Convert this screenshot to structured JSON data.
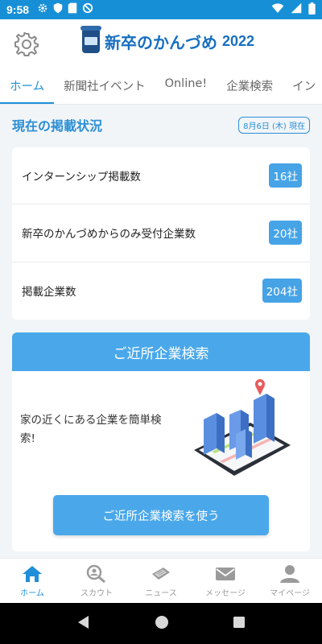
{
  "status_bar": {
    "time": "9:58",
    "left_icons": [
      "gear-icon",
      "shield-icon",
      "sd-card-icon",
      "no-disturb-icon"
    ],
    "right_icons": [
      "wifi-icon",
      "signal-icon",
      "battery-icon"
    ]
  },
  "header": {
    "logo_text": "新卒のかんづめ",
    "logo_year": "2022"
  },
  "tabs": [
    {
      "label": "ホーム",
      "active": true
    },
    {
      "label": "新聞社イベント",
      "active": false
    },
    {
      "label": "Online!",
      "active": false
    },
    {
      "label": "企業検索",
      "active": false
    },
    {
      "label": "イン",
      "active": false
    }
  ],
  "status_section": {
    "title": "現在の掲載状況",
    "date": "8月6日 (木) 現在"
  },
  "stats": [
    {
      "label": "インターンシップ掲載数",
      "value": "16社"
    },
    {
      "label": "新卒のかんづめからのみ受付企業数",
      "value": "20社"
    },
    {
      "label": "掲載企業数",
      "value": "204社"
    }
  ],
  "nearby": {
    "title": "ご近所企業検索",
    "description": "家の近くにある企業を簡単検索!",
    "button_label": "ご近所企業検索を使う"
  },
  "bottom_nav": [
    {
      "label": "ホーム",
      "icon": "home-icon",
      "active": true
    },
    {
      "label": "スカウト",
      "icon": "scout-search-icon",
      "active": false
    },
    {
      "label": "ニュース",
      "icon": "newspaper-icon",
      "active": false
    },
    {
      "label": "メッセージ",
      "icon": "envelope-icon",
      "active": false
    },
    {
      "label": "マイページ",
      "icon": "person-icon",
      "active": false
    }
  ],
  "colors": {
    "accent": "#1f8fd9",
    "status_bar": "#178fd6",
    "badge": "#46a3e6"
  }
}
